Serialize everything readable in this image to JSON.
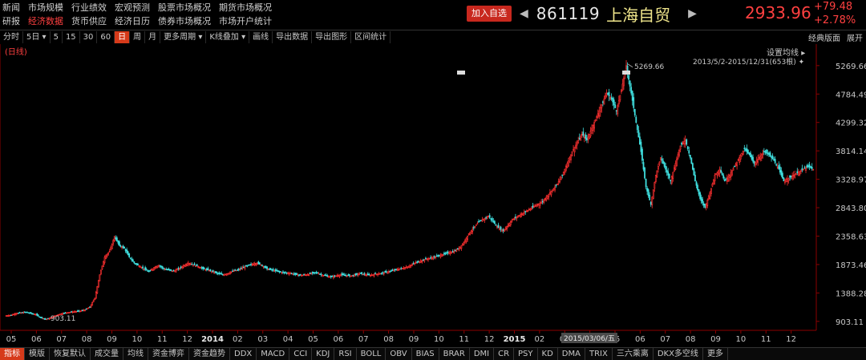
{
  "nav": {
    "row1": [
      "新闻",
      "市场规模",
      "行业绩效",
      "宏观预测",
      "股票市场概况",
      "期货市场概况"
    ],
    "row2": [
      "研报",
      "经济数据",
      "货币供应",
      "经济日历",
      "债券市场概况",
      "市场开户统计"
    ],
    "active_row2_index": 1
  },
  "ticker": {
    "add_label": "加入自选",
    "prev_arrow": "◀",
    "next_arrow": "▶",
    "code": "861119",
    "name": "上海自贸",
    "price": "2933.96",
    "change": "+79.48",
    "change_pct": "+2.78%"
  },
  "toolbar": {
    "items": [
      "分时",
      "5日 ▾",
      "5",
      "15",
      "30",
      "60",
      "日",
      "周",
      "月",
      "更多周期 ▾",
      "K线叠加 ▾",
      "画线",
      "导出数据",
      "导出图形",
      "区间统计"
    ],
    "active_index": 6,
    "right": [
      "经典版面",
      "展开"
    ]
  },
  "chart_labels": {
    "period": "(日线)",
    "ma_setting": "设置均线",
    "range": "2013/5/2-2015/12/31(653根)",
    "current_date": "2015/03/06/五"
  },
  "chart_data": {
    "type": "candlestick",
    "y_ticks": [
      903.11,
      1388.28,
      1873.46,
      2358.63,
      2843.8,
      3328.97,
      3814.14,
      4299.32,
      4784.49,
      5269.66
    ],
    "y_tick_labels": [
      "903.11",
      "1388.28",
      "1873.46",
      "2358.63",
      "2843.80",
      "3328.97",
      "3814.14",
      "4299.32",
      "4784.49",
      "5269.66"
    ],
    "ylim": [
      750,
      5500
    ],
    "x_tick_labels": [
      "05",
      "06",
      "07",
      "08",
      "09",
      "10",
      "11",
      "12",
      "2014",
      "02",
      "03",
      "04",
      "05",
      "06",
      "07",
      "08",
      "09",
      "10",
      "11",
      "12",
      "2015",
      "02",
      "03",
      "04",
      "05",
      "06",
      "07",
      "08",
      "09",
      "10",
      "11",
      "12"
    ],
    "annotations": [
      {
        "label": "5269.66",
        "value": 5269.66
      },
      {
        "label": "903.11",
        "value": 903.11
      }
    ],
    "series_close_approx": [
      1000,
      1010,
      1040,
      1050,
      1060,
      1040,
      1020,
      970,
      940,
      960,
      1000,
      1030,
      1050,
      1060,
      1070,
      1080,
      1100,
      1150,
      1300,
      1700,
      2000,
      2100,
      2350,
      2200,
      2150,
      2000,
      1900,
      1850,
      1800,
      1750,
      1820,
      1860,
      1800,
      1780,
      1760,
      1800,
      1850,
      1900,
      1870,
      1840,
      1800,
      1780,
      1750,
      1720,
      1700,
      1720,
      1760,
      1780,
      1820,
      1850,
      1880,
      1900,
      1860,
      1800,
      1780,
      1760,
      1740,
      1730,
      1720,
      1700,
      1690,
      1700,
      1720,
      1740,
      1700,
      1680,
      1660,
      1680,
      1700,
      1690,
      1680,
      1700,
      1720,
      1700,
      1690,
      1710,
      1720,
      1740,
      1760,
      1780,
      1800,
      1820,
      1850,
      1900,
      1930,
      1960,
      1980,
      2000,
      2030,
      2050,
      2080,
      2100,
      2150,
      2250,
      2400,
      2500,
      2600,
      2650,
      2700,
      2600,
      2500,
      2450,
      2550,
      2650,
      2700,
      2750,
      2800,
      2850,
      2900,
      2950,
      3050,
      3150,
      3250,
      3400,
      3600,
      3800,
      3950,
      4100,
      4000,
      4200,
      4400,
      4600,
      4800,
      4700,
      4500,
      4850,
      5269.66,
      4800,
      4300,
      3800,
      3200,
      2900,
      3400,
      3700,
      3500,
      3300,
      3600,
      3900,
      4000,
      3700,
      3300,
      3000,
      2850,
      3100,
      3400,
      3500,
      3300,
      3400,
      3550,
      3700,
      3850,
      3750,
      3600,
      3700,
      3800,
      3750,
      3650,
      3500,
      3300,
      3350,
      3400,
      3450,
      3500,
      3550,
      3500
    ],
    "grid": false,
    "up_color": "#ff3030",
    "down_color": "#40e0e0"
  },
  "bottom_tabs": {
    "items": [
      "指标",
      "模版",
      "恢复默认",
      "成交量",
      "均线",
      "资金博弈",
      "资金趋势",
      "DDX",
      "MACD",
      "CCI",
      "KDJ",
      "RSI",
      "BOLL",
      "OBV",
      "BIAS",
      "BRAR",
      "DMI",
      "CR",
      "PSY",
      "KD",
      "DMA",
      "TRIX",
      "三六乘离",
      "DKX多空线",
      "更多"
    ],
    "active_index": 0
  },
  "colors": {
    "up": "#ff3030",
    "down": "#40e0e0",
    "accent": "#d63a1a",
    "axis": "#8b0000",
    "name": "#f0e68c"
  }
}
